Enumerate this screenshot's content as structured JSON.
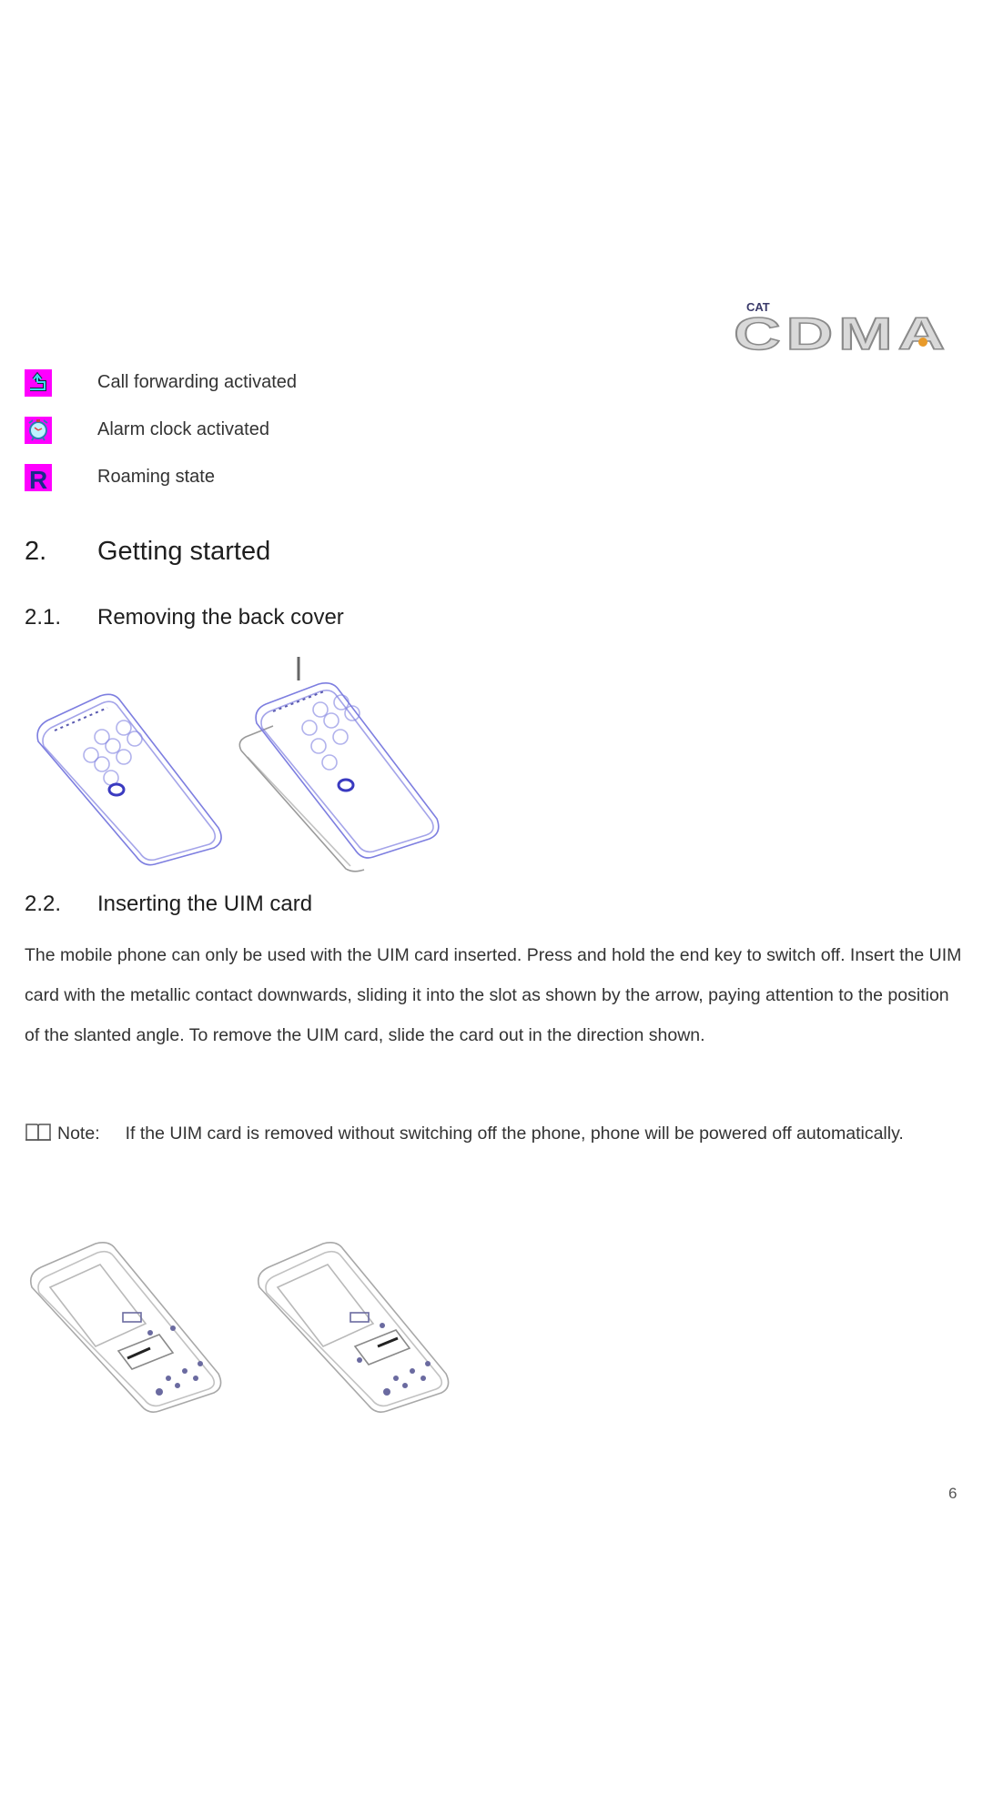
{
  "header": {
    "logo": {
      "small_text": "CAT",
      "main_text": "CDMA"
    }
  },
  "status_icons": [
    {
      "icon": "call-forwarding-icon",
      "label": "Call forwarding activated"
    },
    {
      "icon": "alarm-clock-icon",
      "label": "Alarm clock activated"
    },
    {
      "icon": "roaming-icon",
      "glyph": "R",
      "label": "Roaming state"
    }
  ],
  "section": {
    "number": "2.",
    "title": "Getting started",
    "subsections": [
      {
        "number": "2.1.",
        "title": "Removing the back cover"
      },
      {
        "number": "2.2.",
        "title": "Inserting the UIM card"
      }
    ]
  },
  "body": {
    "paragraph": "The mobile phone can only be used with the UIM card inserted. Press and hold the end key to switch off. Insert the UIM card with the metallic contact downwards, sliding it into the slot as shown by the arrow, paying attention to the position of the slanted angle. To remove the UIM card, slide the card out in the direction shown.",
    "note_label": "Note:",
    "note_text": "If the UIM card is removed without switching off the phone, phone will be powered off automatically."
  },
  "footer": {
    "page_number": "6"
  },
  "colors": {
    "icon_background": "#ff00ff",
    "illustration_line": "#7d7ee0",
    "illustration_gray": "#9a9a9a"
  }
}
